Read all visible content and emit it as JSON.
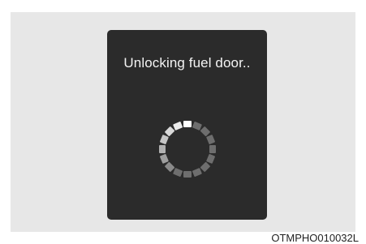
{
  "screen": {
    "message": "Unlocking fuel door..",
    "spinner": {
      "icon": "loading-spinner-icon",
      "segments": 16,
      "active_color": "#ffffff",
      "inactive_color": "#4e4e4e"
    }
  },
  "caption": "OTMPHO010032L",
  "colors": {
    "screen_background": "#2b2b2b",
    "panel_background": "#e7e7e7"
  }
}
